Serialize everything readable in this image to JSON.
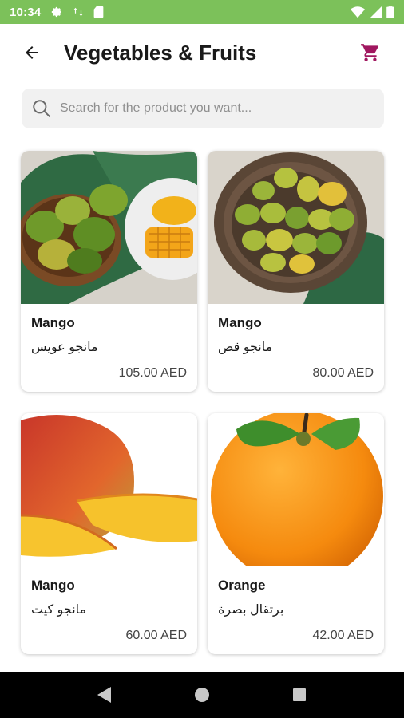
{
  "status_bar": {
    "time": "10:34"
  },
  "header": {
    "title": "Vegetables & Fruits"
  },
  "search": {
    "placeholder": "Search for the product you want..."
  },
  "products": [
    {
      "name": "Mango",
      "name_ar": "مانجو عويس",
      "price": "105.00 AED"
    },
    {
      "name": "Mango",
      "name_ar": "مانجو قص",
      "price": "80.00 AED"
    },
    {
      "name": "Mango",
      "name_ar": "مانجو كيت",
      "price": "60.00 AED"
    },
    {
      "name": "Orange",
      "name_ar": "برتقال بصرة",
      "price": "42.00 AED"
    }
  ],
  "colors": {
    "status_bar": "#7cc15a",
    "accent": "#a0175f"
  },
  "icons": {
    "back": "arrow-left-icon",
    "cart": "shopping-cart-icon",
    "search": "search-icon",
    "nav_back": "triangle-back-icon",
    "nav_home": "circle-home-icon",
    "nav_recents": "square-recents-icon"
  }
}
